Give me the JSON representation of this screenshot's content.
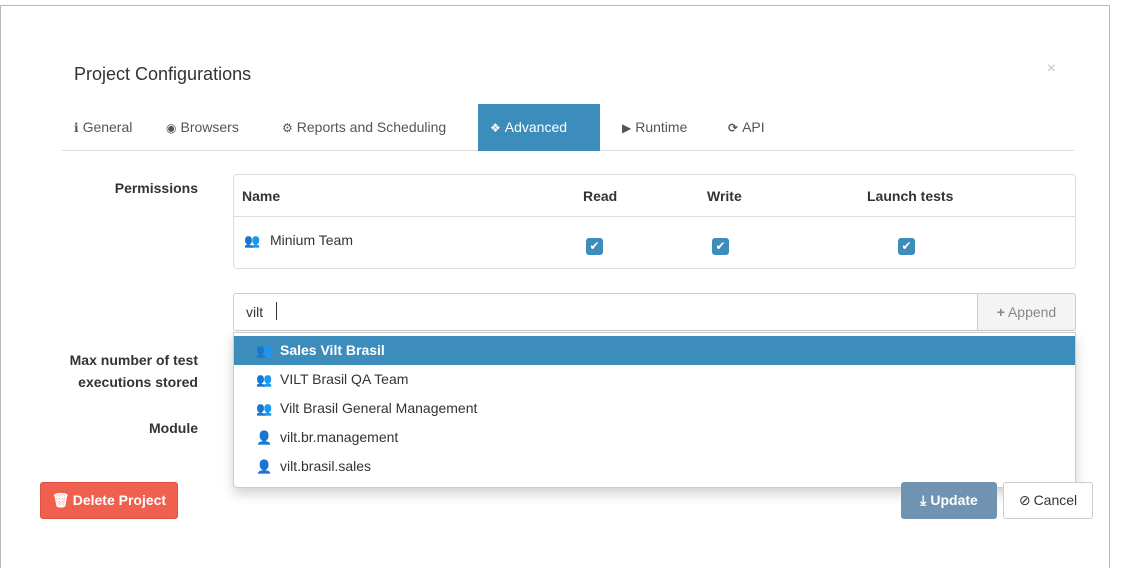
{
  "modal": {
    "title": "Project Configurations",
    "close_symbol": "×"
  },
  "tabs": [
    {
      "label": "General",
      "icon": "info-icon",
      "glyph": "i",
      "active": false
    },
    {
      "label": "Browsers",
      "icon": "globe-icon",
      "glyph": "◉",
      "active": false
    },
    {
      "label": "Reports and Scheduling",
      "icon": "gears-icon",
      "glyph": "⚙",
      "active": false
    },
    {
      "label": "Advanced",
      "icon": "cubes-icon",
      "glyph": "❖",
      "active": true
    },
    {
      "label": "Runtime",
      "icon": "play-icon",
      "glyph": "▶",
      "active": false
    },
    {
      "label": "API",
      "icon": "refresh-icon",
      "glyph": "⟳",
      "active": false
    }
  ],
  "permissions": {
    "label": "Permissions",
    "columns": [
      "Name",
      "Read",
      "Write",
      "Launch tests"
    ],
    "rows": [
      {
        "name": "Minium Team",
        "icon": "users-icon",
        "read": true,
        "write": true,
        "launch_tests": true
      }
    ]
  },
  "search": {
    "value": "vilt",
    "append_label": "Append",
    "append_glyph": "+"
  },
  "dropdown": {
    "items": [
      {
        "label": "Sales Vilt Brasil",
        "icon": "users-icon",
        "active": true
      },
      {
        "label": "VILT Brasil QA Team",
        "icon": "users-icon",
        "active": false
      },
      {
        "label": "Vilt Brasil General Management",
        "icon": "users-icon",
        "active": false
      },
      {
        "label": "vilt.br.management",
        "icon": "user-icon",
        "active": false
      },
      {
        "label": "vilt.brasil.sales",
        "icon": "user-icon",
        "active": false
      }
    ]
  },
  "fields": {
    "max_executions_label_line1": "Max number of test",
    "max_executions_label_line2": "executions stored",
    "module_label": "Module"
  },
  "buttons": {
    "delete_label": "Delete Project",
    "update_label": "Update",
    "cancel_label": "Cancel"
  },
  "colors": {
    "primary": "#3c8dbc",
    "danger": "#f0604e",
    "update_disabled": "#6f93b0"
  }
}
